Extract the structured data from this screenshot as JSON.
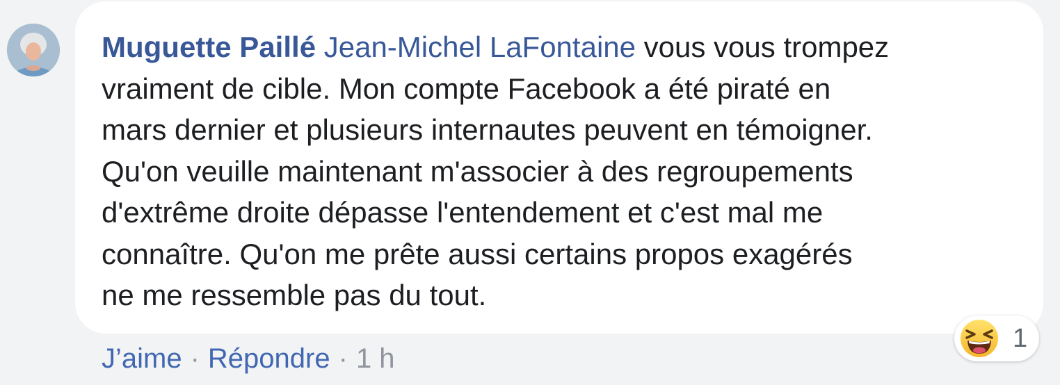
{
  "comment": {
    "author": "Muguette Paillé",
    "mention": "Jean-Michel LaFontaine",
    "lines": [
      " vous vous trompez",
      "vraiment de cible. Mon compte Facebook a été piraté en",
      "mars dernier et plusieurs internautes peuvent en témoigner.",
      "Qu'on veuille maintenant m'associer à des regroupements",
      "d'extrême droite dépasse l'entendement et c'est mal me",
      "connaître. Qu'on me prête aussi certains propos exagérés",
      "ne me ressemble pas du tout."
    ]
  },
  "reactions": {
    "icon": "laughing-face-icon",
    "count": "1"
  },
  "actions": {
    "like": "J’aime",
    "separator": "·",
    "reply": "Répondre",
    "time": "1 h"
  }
}
